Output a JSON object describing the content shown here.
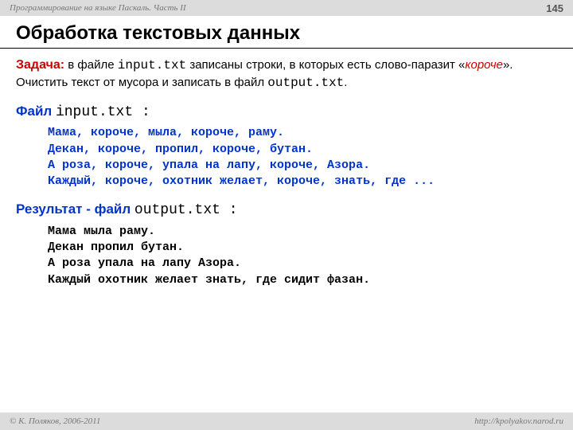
{
  "header": {
    "course": "Программирование на языке Паскаль. Часть II",
    "page": "145"
  },
  "title": "Обработка текстовых данных",
  "task": {
    "label": "Задача:",
    "part1": " в файле ",
    "file_in": "input.txt",
    "part2": " записаны строки, в которых есть слово-паразит «",
    "parasite": "короче",
    "part3": "». Очистить текст от мусора и записать в файл ",
    "file_out": "output.txt",
    "part4": "."
  },
  "input_section": {
    "label": "Файл ",
    "filename": "input.txt",
    "colon": " :",
    "lines": [
      "Мама, короче, мыла, короче, раму.",
      "Декан, короче, пропил, короче, бутан.",
      "А роза, короче, упала на лапу, короче, Азора.",
      "Каждый, короче, охотник желает, короче, знать, где ..."
    ]
  },
  "output_section": {
    "label": "Результат - файл ",
    "filename": "output.txt",
    "colon": " :",
    "lines": [
      "Мама мыла раму.",
      "Декан пропил бутан.",
      "А роза упала на лапу Азора.",
      "Каждый охотник желает знать, где сидит фазан."
    ]
  },
  "footer": {
    "copyright": "© К. Поляков, 2006-2011",
    "url": "http://kpolyakov.narod.ru"
  }
}
